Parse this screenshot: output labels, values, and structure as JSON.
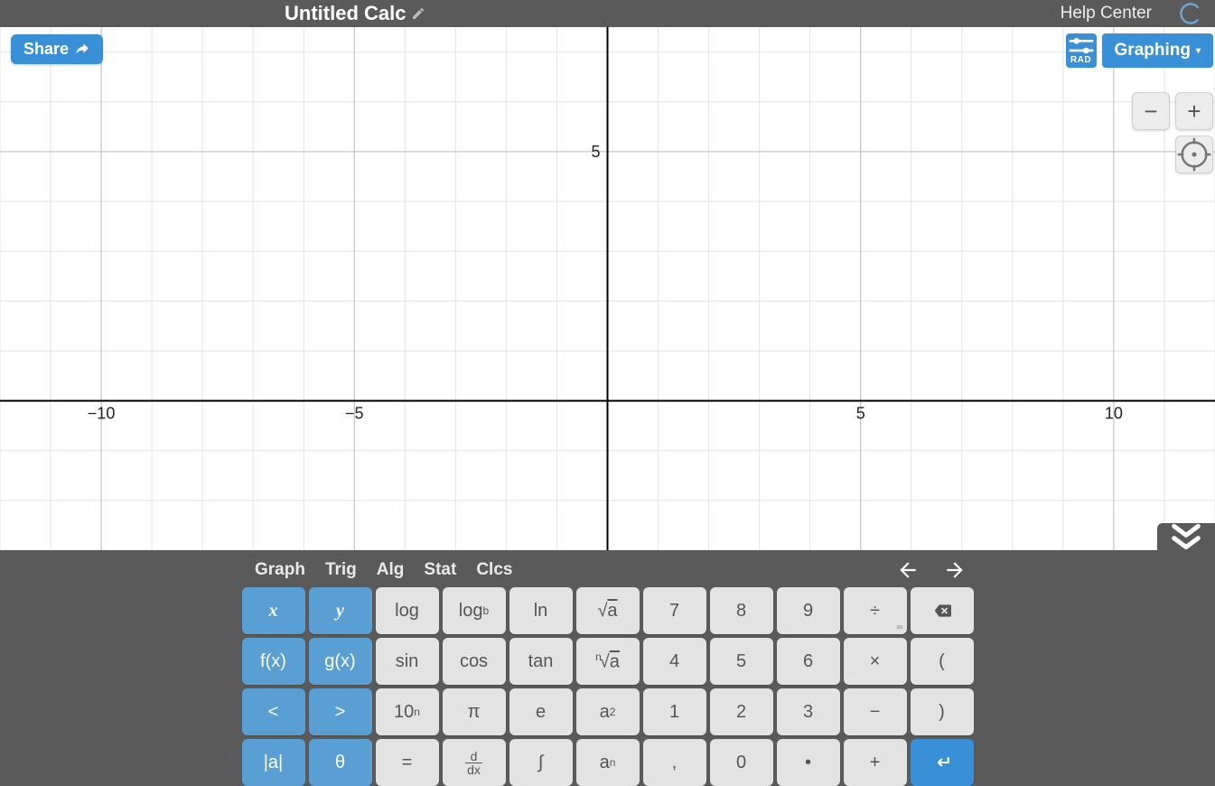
{
  "header": {
    "title": "Untitled Calc",
    "help_link": "Help Center"
  },
  "toolbar": {
    "share_label": "Share",
    "angle_mode": "RAD",
    "mode_label": "Graphing"
  },
  "zoom": {
    "out": "−",
    "in": "+"
  },
  "collapse_icon": "chevrons-down",
  "keyboard": {
    "tabs": [
      "Graph",
      "Trig",
      "Alg",
      "Stat",
      "Clcs"
    ],
    "rows": [
      [
        {
          "id": "x",
          "label": "x",
          "cls": "blue",
          "ital": true
        },
        {
          "id": "y",
          "label": "y",
          "cls": "blue",
          "ital": true
        },
        {
          "id": "log",
          "label": "log",
          "cls": "gray"
        },
        {
          "id": "logb",
          "label": "log",
          "sub": "b",
          "cls": "gray"
        },
        {
          "id": "ln",
          "label": "ln",
          "cls": "gray"
        },
        {
          "id": "sqrt",
          "label": "√a",
          "cls": "gray",
          "overline": true
        },
        {
          "id": "7",
          "label": "7",
          "cls": "gray"
        },
        {
          "id": "8",
          "label": "8",
          "cls": "gray"
        },
        {
          "id": "9",
          "label": "9",
          "cls": "gray"
        },
        {
          "id": "div",
          "label": "÷",
          "cls": "gray",
          "corner": "∞"
        },
        {
          "id": "backspace",
          "label": "",
          "cls": "gray",
          "icon": "backspace"
        }
      ],
      [
        {
          "id": "fx",
          "label": "f(x)",
          "cls": "blue"
        },
        {
          "id": "gx",
          "label": "g(x)",
          "cls": "blue"
        },
        {
          "id": "sin",
          "label": "sin",
          "cls": "gray"
        },
        {
          "id": "cos",
          "label": "cos",
          "cls": "gray"
        },
        {
          "id": "tan",
          "label": "tan",
          "cls": "gray"
        },
        {
          "id": "nroot",
          "label": "√a",
          "presup": "n",
          "cls": "gray",
          "overline": true
        },
        {
          "id": "4",
          "label": "4",
          "cls": "gray"
        },
        {
          "id": "5",
          "label": "5",
          "cls": "gray"
        },
        {
          "id": "6",
          "label": "6",
          "cls": "gray"
        },
        {
          "id": "mul",
          "label": "×",
          "cls": "gray"
        },
        {
          "id": "lparen",
          "label": "(",
          "cls": "gray"
        }
      ],
      [
        {
          "id": "lt",
          "label": "<",
          "cls": "blue"
        },
        {
          "id": "gt",
          "label": ">",
          "cls": "blue"
        },
        {
          "id": "tenp",
          "label": "10",
          "sup": "n",
          "cls": "gray"
        },
        {
          "id": "pi",
          "label": "π",
          "cls": "gray"
        },
        {
          "id": "e",
          "label": "e",
          "cls": "gray"
        },
        {
          "id": "asq",
          "label": "a",
          "sup": "2",
          "cls": "gray"
        },
        {
          "id": "1",
          "label": "1",
          "cls": "gray"
        },
        {
          "id": "2",
          "label": "2",
          "cls": "gray"
        },
        {
          "id": "3",
          "label": "3",
          "cls": "gray"
        },
        {
          "id": "minus",
          "label": "−",
          "cls": "gray"
        },
        {
          "id": "rparen",
          "label": ")",
          "cls": "gray"
        }
      ],
      [
        {
          "id": "abs",
          "label": "|a|",
          "cls": "blue"
        },
        {
          "id": "theta",
          "label": "θ",
          "cls": "blue"
        },
        {
          "id": "eq",
          "label": "=",
          "cls": "gray"
        },
        {
          "id": "ddx",
          "label": "",
          "cls": "gray",
          "frac": [
            "d",
            "dx"
          ]
        },
        {
          "id": "integral",
          "label": "∫",
          "cls": "gray"
        },
        {
          "id": "apown",
          "label": "a",
          "sup": "n",
          "cls": "gray"
        },
        {
          "id": "comma",
          "label": ",",
          "cls": "gray"
        },
        {
          "id": "0",
          "label": "0",
          "cls": "gray"
        },
        {
          "id": "dot",
          "label": "•",
          "cls": "gray"
        },
        {
          "id": "plus",
          "label": "+",
          "cls": "gray"
        },
        {
          "id": "enter",
          "label": "",
          "cls": "enter",
          "icon": "enter"
        }
      ]
    ]
  },
  "chart_data": {
    "type": "scatter",
    "title": "",
    "xlabel": "",
    "ylabel": "",
    "x_ticks": [
      -10,
      -5,
      5,
      10
    ],
    "y_ticks": [
      5
    ],
    "xlim": [
      -12,
      12
    ],
    "ylim": [
      -3,
      7.5
    ],
    "series": [],
    "grid": true
  }
}
